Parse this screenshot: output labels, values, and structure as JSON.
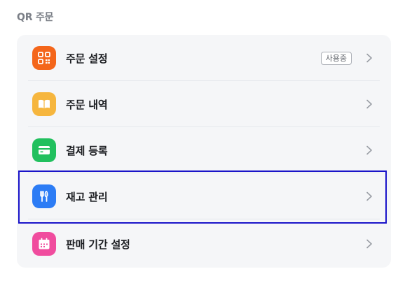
{
  "section": {
    "title": "QR 주문"
  },
  "items": [
    {
      "label": "주문 설정",
      "icon": "qr-code-icon",
      "color": "#f4661b",
      "badge": "사용중"
    },
    {
      "label": "주문 내역",
      "icon": "book-icon",
      "color": "#f6b63e"
    },
    {
      "label": "결제 등록",
      "icon": "card-icon",
      "color": "#21c05e"
    },
    {
      "label": "재고 관리",
      "icon": "utensils-icon",
      "color": "#2c7cf5"
    },
    {
      "label": "판매 기간 설정",
      "icon": "calendar-icon",
      "color": "#f04c9e"
    }
  ],
  "highlight_color": "#1a14c9"
}
